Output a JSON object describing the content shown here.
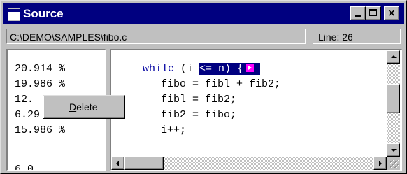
{
  "window": {
    "title": "Source"
  },
  "titlebar_buttons": {
    "minimize": "minimize-icon",
    "maximize": "maximize-icon",
    "close": "×"
  },
  "status": {
    "path": "C:\\DEMO\\SAMPLES\\fibo.c",
    "line": "Line: 26"
  },
  "percentages": [
    "20.914 %",
    "19.986 %",
    "12.",
    "6.29",
    "15.986 %",
    "6.0"
  ],
  "code": {
    "line1_keyword": "while",
    "line1_before_sel": " (i ",
    "line1_selected": "<= n) {",
    "line2": "fibo = fibl + fib2;",
    "line3": "fibl = fib2;",
    "line4": "fib2 = fibo;",
    "line5": "i++;"
  },
  "context_menu": {
    "delete": "Delete"
  }
}
